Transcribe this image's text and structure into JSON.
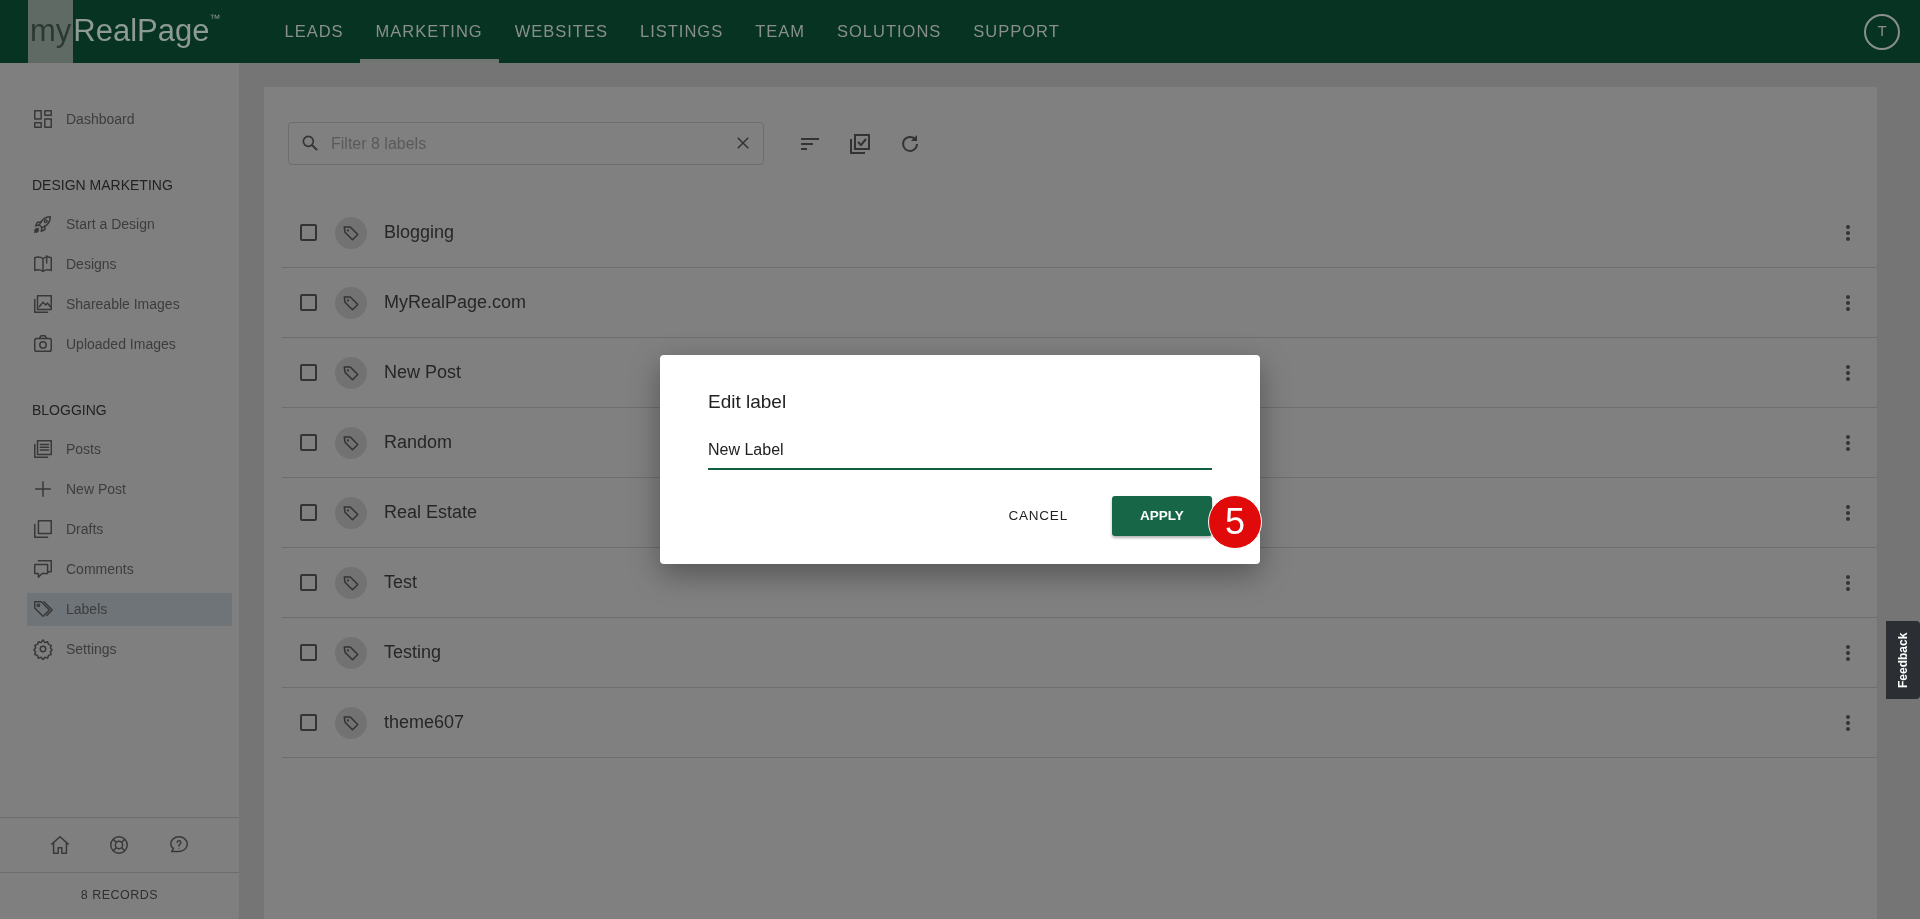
{
  "header": {
    "logo": {
      "prefix": "my",
      "text": "RealPage",
      "trademark": "™"
    },
    "nav": [
      {
        "label": "LEADS",
        "selected": false
      },
      {
        "label": "MARKETING",
        "selected": true
      },
      {
        "label": "WEBSITES",
        "selected": false
      },
      {
        "label": "LISTINGS",
        "selected": false
      },
      {
        "label": "TEAM",
        "selected": false
      },
      {
        "label": "SOLUTIONS",
        "selected": false
      },
      {
        "label": "SUPPORT",
        "selected": false
      }
    ],
    "avatar": "T"
  },
  "sidebar": {
    "sections": [
      {
        "items": [
          {
            "label": "Dashboard",
            "selected": false
          }
        ]
      },
      {
        "heading": "DESIGN MARKETING",
        "items": [
          {
            "label": "Start a Design",
            "selected": false
          },
          {
            "label": "Designs",
            "selected": false
          },
          {
            "label": "Shareable Images",
            "selected": false
          },
          {
            "label": "Uploaded Images",
            "selected": false
          }
        ]
      },
      {
        "heading": "BLOGGING",
        "items": [
          {
            "label": "Posts",
            "selected": false
          },
          {
            "label": "New Post",
            "selected": false
          },
          {
            "label": "Drafts",
            "selected": false
          },
          {
            "label": "Comments",
            "selected": false
          },
          {
            "label": "Labels",
            "selected": true
          },
          {
            "label": "Settings",
            "selected": false
          }
        ]
      }
    ],
    "records": "8 RECORDS"
  },
  "toolbar": {
    "search": {
      "placeholder": "Filter 8 labels"
    }
  },
  "labels": [
    {
      "name": "Blogging",
      "checked": false
    },
    {
      "name": "MyRealPage.com",
      "checked": false
    },
    {
      "name": "New Post",
      "checked": false
    },
    {
      "name": "Random",
      "checked": false
    },
    {
      "name": "Real Estate",
      "checked": false
    },
    {
      "name": "Test",
      "checked": false
    },
    {
      "name": "Testing",
      "checked": false
    },
    {
      "name": "theme607",
      "checked": false
    }
  ],
  "dialog": {
    "title": "Edit label",
    "field": {
      "value": "New Label"
    },
    "buttons": [
      {
        "label": "CANCEL",
        "kind": "text"
      },
      {
        "label": "APPLY",
        "kind": "primary"
      }
    ],
    "step_marker": "5"
  },
  "feedback": "Feedback"
}
